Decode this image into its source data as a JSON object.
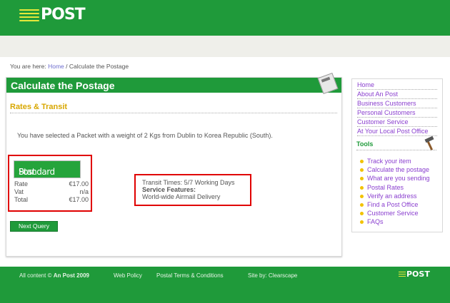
{
  "header": {
    "logo_text": "POST"
  },
  "breadcrumb": {
    "prefix": "You are here:",
    "home": "Home",
    "separator": "/",
    "current": "Calculate the Postage"
  },
  "main": {
    "title": "Calculate the Postage",
    "subtitle": "Rates & Transit",
    "summary": "You have selected a Packet with a weight of 2 Kgs from Dublin to Korea Republic (South).",
    "service": {
      "logo_standard": "Standard",
      "logo_post": "Post",
      "rows": [
        {
          "label": "Rate",
          "value": "€17.00"
        },
        {
          "label": "Vat",
          "value": "n/a"
        },
        {
          "label": "Total",
          "value": "€17.00"
        }
      ]
    },
    "transit": {
      "times": "Transit Times: 5/7 Working Days",
      "features_label": "Service Features:",
      "features_value": "World-wide Airmail Delivery"
    },
    "next_query": "Next Query"
  },
  "sidebar": {
    "links": [
      "Home",
      "About An Post",
      "Business Customers",
      "Personal Customers",
      "Customer Service",
      "At Your Local Post Office"
    ],
    "tools_title": "Tools",
    "tools": [
      "Track your item",
      "Calculate the postage",
      "What are you sending",
      "Postal Rates",
      "Verify an address",
      "Find a Post Office",
      "Customer Service",
      "FAQs"
    ]
  },
  "footer": {
    "copyright_prefix": "All content ©",
    "copyright_owner": "An Post 2009",
    "web_policy": "Web Policy",
    "terms": "Postal Terms & Conditions",
    "site_by": "Site by: Clearscape",
    "logo_text": "POST"
  },
  "colors": {
    "brand_green": "#1f9a3a",
    "highlight_red": "#e00000",
    "subtitle_gold": "#d8a700",
    "link_purple": "#8a3fcf"
  }
}
